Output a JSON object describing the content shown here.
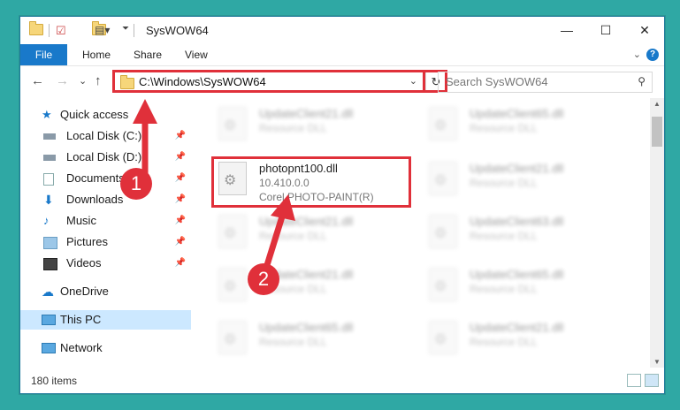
{
  "window": {
    "title": "SysWOW64",
    "minimize": "—",
    "maximize": "☐",
    "close": "✕"
  },
  "ribbon": {
    "tabs": [
      "File",
      "Home",
      "Share",
      "View"
    ],
    "expand": "⌄",
    "help": "?"
  },
  "nav": {
    "back": "←",
    "forward": "→",
    "recent": "⌄",
    "up": "↑",
    "address": "C:\\Windows\\SysWOW64",
    "address_chevron": "⌄",
    "refresh": "↻",
    "search_placeholder": "Search SysWOW64"
  },
  "sidebar": {
    "quick_access": "Quick access",
    "items": [
      {
        "label": "Local Disk (C:)",
        "icon": "drive-icon"
      },
      {
        "label": "Local Disk (D:)",
        "icon": "drive-icon"
      },
      {
        "label": "Documents",
        "icon": "documents-icon"
      },
      {
        "label": "Downloads",
        "icon": "downloads-icon"
      },
      {
        "label": "Music",
        "icon": "music-icon"
      },
      {
        "label": "Pictures",
        "icon": "pictures-icon"
      },
      {
        "label": "Videos",
        "icon": "videos-icon"
      }
    ],
    "onedrive": "OneDrive",
    "this_pc": "This PC",
    "network": "Network",
    "pin": "📌"
  },
  "files": {
    "left": [
      {
        "name": "UpdateClient21.dll",
        "desc": "Resource DLL"
      },
      {
        "name": "photopnt100.dll",
        "desc": "10.410.0.0",
        "desc2": "Corel PHOTO-PAINT(R)"
      },
      {
        "name": "UpdateClient21.dll",
        "desc": "Resource DLL"
      },
      {
        "name": "UpdateClient21.dll",
        "desc": "Resource DLL"
      },
      {
        "name": "UpdateClient65.dll",
        "desc": "Resource DLL"
      }
    ],
    "right": [
      {
        "name": "UpdateClient65.dll",
        "desc": "Resource DLL"
      },
      {
        "name": "UpdateClient21.dll",
        "desc": "Resource DLL"
      },
      {
        "name": "UpdateClient63.dll",
        "desc": "Resource DLL"
      },
      {
        "name": "UpdateClient65.dll",
        "desc": "Resource DLL"
      },
      {
        "name": "UpdateClient21.dll",
        "desc": "Resource DLL"
      }
    ]
  },
  "status": {
    "count": "180 items"
  },
  "annotations": {
    "step1": "1",
    "step2": "2"
  }
}
